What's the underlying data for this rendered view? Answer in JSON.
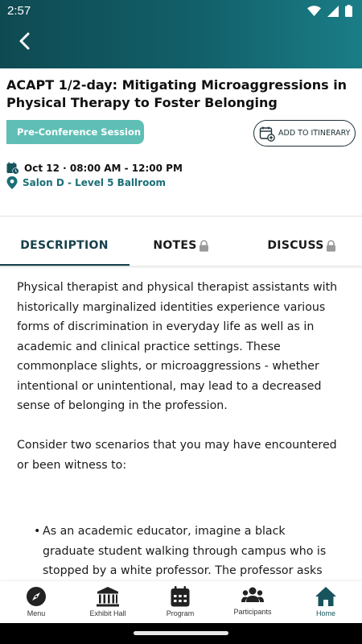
{
  "status_bar": {
    "time": "2:57"
  },
  "session": {
    "title": "ACAPT 1/2-day: Mitigating Microaggressions in Physical Therapy to Foster Belonging",
    "badge": "Pre-Conference Session",
    "add_to_itinerary": "ADD TO ITINERARY",
    "date_time": "Oct 12 · 08:00 AM - 12:00 PM",
    "location": "Salon D - Level 5 Ballroom"
  },
  "tabs": [
    {
      "label": "DESCRIPTION",
      "locked": false
    },
    {
      "label": "NOTES",
      "locked": true
    },
    {
      "label": "DISCUSS",
      "locked": true
    }
  ],
  "description": {
    "paragraphs": [
      "Physical therapist and physical therapist assistants with historically marginalized identities experience various forms of discrimination in everyday life as well as in academic and clinical practice settings. These commonplace slights, or microaggressions - whether intentional or unintentional, may lead to a decreased sense of belonging in the profession.",
      "Consider two scenarios that you may have encountered or been witness to:"
    ],
    "bullets": [
      "As an academic educator, imagine a black graduate student walking through campus who is stopped by a white professor. The professor asks"
    ]
  },
  "bottom_nav": [
    {
      "label": "Menu",
      "icon": "compass-icon"
    },
    {
      "label": "Exhibit Hall",
      "icon": "building-icon"
    },
    {
      "label": "Program",
      "icon": "calendar-icon"
    },
    {
      "label": "Participants",
      "icon": "people-icon"
    },
    {
      "label": "Home",
      "icon": "home-icon",
      "active": true
    }
  ],
  "colors": {
    "accent": "#16404a",
    "badge": "#5fbfb6",
    "location": "#1a6f77"
  }
}
